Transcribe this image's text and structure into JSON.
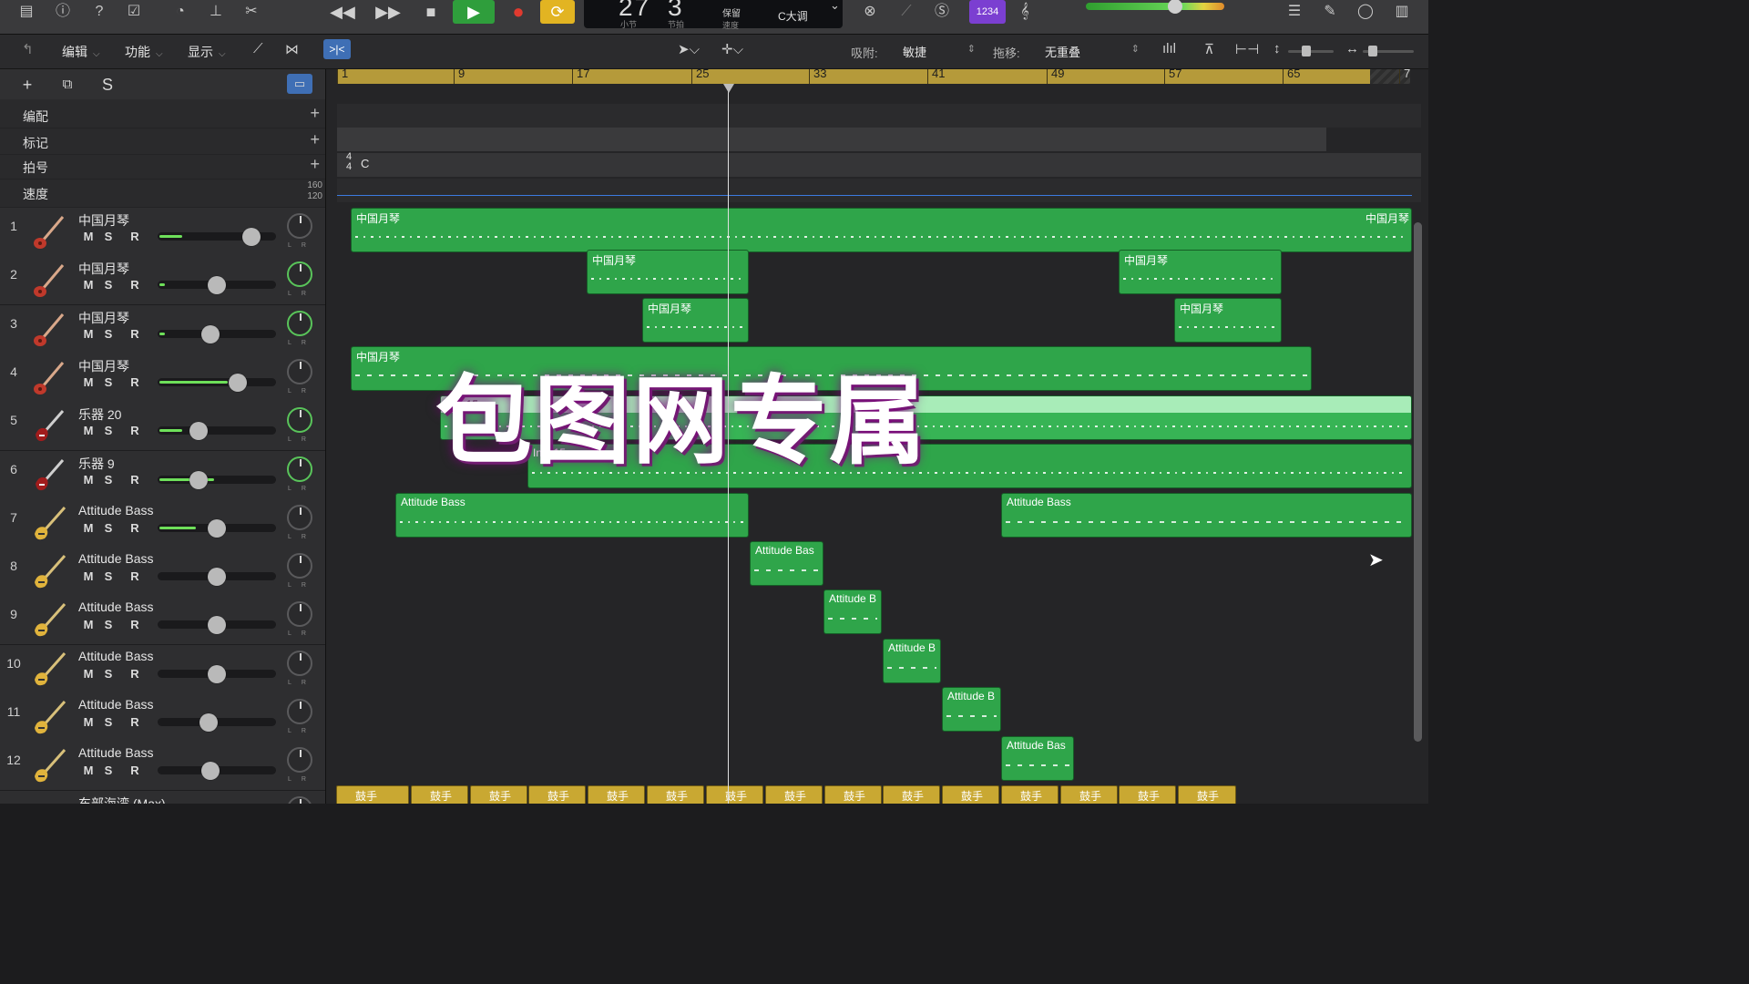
{
  "transport": {
    "bar": "27",
    "beat": "3",
    "bar_label": "小节",
    "beat_label": "节拍",
    "keep_label": "保留",
    "tempo_label": "速度",
    "key": "C大调",
    "count_in": "1234"
  },
  "toolbar": {
    "edit": "编辑",
    "functions": "功能",
    "view": "显示",
    "snap_label": "吸附:",
    "snap_value": "敏捷",
    "drag_label": "拖移:",
    "drag_value": "无重叠"
  },
  "left_header": {
    "solo": "S"
  },
  "global_tracks": [
    {
      "name": "编配"
    },
    {
      "name": "标记"
    },
    {
      "name": "拍号"
    },
    {
      "name": "速度"
    }
  ],
  "tempo_scale": {
    "high": "160",
    "low": "120"
  },
  "signature": {
    "top": "4",
    "bottom": "4",
    "key": "C"
  },
  "ruler": [
    "1",
    "9",
    "17",
    "25",
    "33",
    "41",
    "49",
    "57",
    "65",
    "7"
  ],
  "tracks": [
    {
      "num": "1",
      "name": "中国月琴",
      "icon": "lute-icon"
    },
    {
      "num": "2",
      "name": "中国月琴",
      "icon": "lute-icon"
    },
    {
      "num": "3",
      "name": "中国月琴",
      "icon": "lute-icon"
    },
    {
      "num": "4",
      "name": "中国月琴",
      "icon": "lute-icon"
    },
    {
      "num": "5",
      "name": "乐器 20",
      "icon": "electric-guitar-icon"
    },
    {
      "num": "6",
      "name": "乐器 9",
      "icon": "electric-guitar-icon"
    },
    {
      "num": "7",
      "name": "Attitude Bass",
      "icon": "bass-guitar-icon"
    },
    {
      "num": "8",
      "name": "Attitude Bass",
      "icon": "bass-guitar-icon"
    },
    {
      "num": "9",
      "name": "Attitude Bass",
      "icon": "bass-guitar-icon"
    },
    {
      "num": "10",
      "name": "Attitude Bass",
      "icon": "bass-guitar-icon"
    },
    {
      "num": "11",
      "name": "Attitude Bass",
      "icon": "bass-guitar-icon"
    },
    {
      "num": "12",
      "name": "Attitude Bass",
      "icon": "bass-guitar-icon"
    },
    {
      "num": "",
      "name": "东部海湾 (Max)",
      "icon": "drummer-icon"
    }
  ],
  "track_buttons": {
    "mute": "M",
    "solo": "S",
    "record": "R"
  },
  "regions": {
    "t1": "中国月琴",
    "t1b": "中国月琴",
    "t2a": "中国月琴",
    "t2b": "中国月琴",
    "t3a": "中国月琴",
    "t3b": "中国月琴",
    "t4": "中国月琴",
    "t5": "Inst 15",
    "t6": "Inst 15",
    "t7a": "Attitude Bass",
    "t7b": "Attitude Bass",
    "t8": "Attitude Bas",
    "t9": "Attitude B",
    "t10": "Attitude B",
    "t11": "Attitude B",
    "t12": "Attitude Bas",
    "drum": "鼓手"
  },
  "watermark": "包图网专属",
  "colors": {
    "region_green": "#2fa54a",
    "drummer_yellow": "#c9a832",
    "ruler_gold": "#b59a3a",
    "record_red": "#e03a2f",
    "cycle_yellow": "#e2b422"
  }
}
